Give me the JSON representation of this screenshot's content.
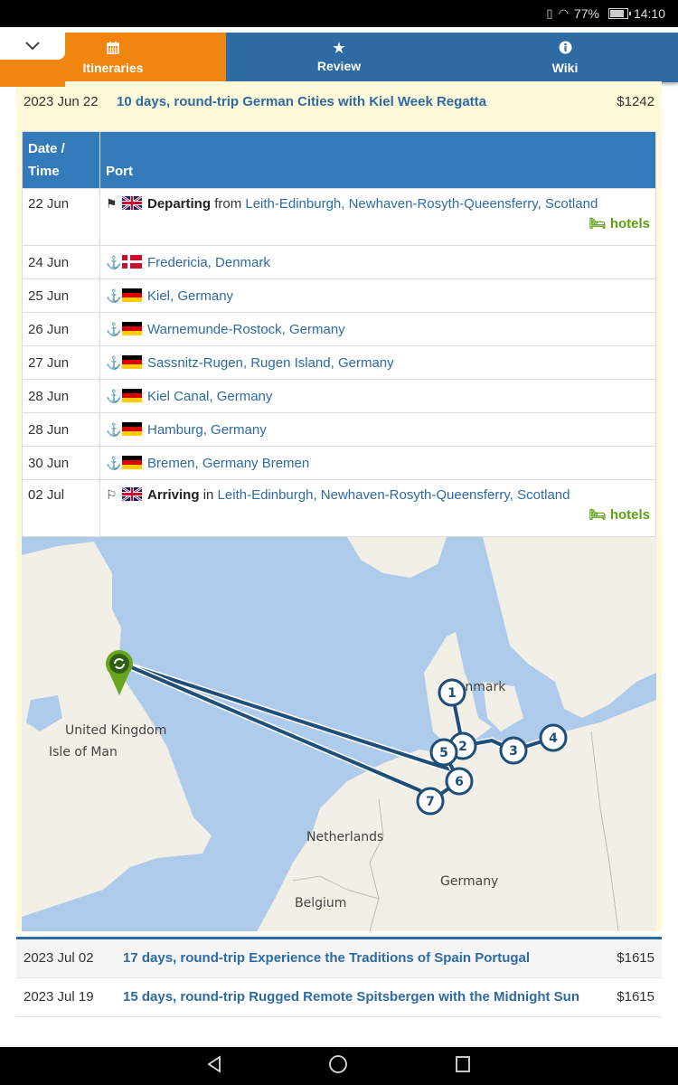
{
  "status_bar": {
    "battery": "77%",
    "time": "14:10"
  },
  "nav": {
    "tabs": [
      {
        "label": "Itineraries",
        "icon": "calendar-icon",
        "active": true
      },
      {
        "label": "Review",
        "icon": "star-icon",
        "active": false
      },
      {
        "label": "Wiki",
        "icon": "info-icon",
        "active": false
      }
    ]
  },
  "cruise": {
    "date": "2023 Jun 22",
    "title": "10 days, round-trip German Cities with Kiel Week Regatta",
    "price": "$1242",
    "table_headers": {
      "date": "Date / Time",
      "date_line1": "Date /",
      "date_line2": "Time",
      "port": "Port"
    },
    "rows": [
      {
        "date": "22 Jun",
        "icon": "flag-icon",
        "flag": "gb",
        "prefix": "Departing",
        "connector": "from",
        "port": "Leith-Edinburgh, Newhaven-Rosyth-Queensferry, Scotland",
        "hotels": "hotels"
      },
      {
        "date": "24 Jun",
        "icon": "anchor-icon",
        "flag": "dk",
        "port": "Fredericia, Denmark"
      },
      {
        "date": "25 Jun",
        "icon": "anchor-icon",
        "flag": "de",
        "port": "Kiel, Germany"
      },
      {
        "date": "26 Jun",
        "icon": "anchor-icon",
        "flag": "de",
        "port": "Warnemunde-Rostock, Germany"
      },
      {
        "date": "27 Jun",
        "icon": "anchor-icon",
        "flag": "de",
        "port": "Sassnitz-Rugen, Rugen Island, Germany"
      },
      {
        "date": "28 Jun",
        "icon": "anchor-icon",
        "flag": "de",
        "port": "Kiel Canal, Germany"
      },
      {
        "date": "28 Jun",
        "icon": "anchor-icon",
        "flag": "de",
        "port": "Hamburg, Germany"
      },
      {
        "date": "30 Jun",
        "icon": "anchor-icon",
        "flag": "de",
        "port": "Bremen, Germany Bremen"
      },
      {
        "date": "02 Jul",
        "icon": "checkered-flag-icon",
        "flag": "gb",
        "prefix": "Arriving",
        "connector": "in",
        "port": "Leith-Edinburgh, Newhaven-Rosyth-Queensferry, Scotland",
        "hotels": "hotels"
      }
    ],
    "map": {
      "labels": [
        "United Kingdom",
        "Isle of Man",
        "Netherlands",
        "Germany",
        "Belgium",
        "Denmark"
      ],
      "markers": [
        "1",
        "2",
        "3",
        "4",
        "5",
        "6",
        "7"
      ],
      "route_color": "#1f4e79",
      "start_marker_color": "#5ea014"
    }
  },
  "other_cruises": [
    {
      "date": "2023 Jul 02",
      "title": "17 days, round-trip Experience the Traditions of Spain Portugal",
      "price": "$1615"
    },
    {
      "date": "2023 Jul 19",
      "title": "15 days, round-trip Rugged Remote Spitsbergen with the Midnight Sun",
      "price": "$1615"
    }
  ],
  "colors": {
    "orange": "#f0850f",
    "blue": "#2e6aa3",
    "header_blue": "#327ab9",
    "cream": "#fdf9d9",
    "green": "#5ea014"
  }
}
